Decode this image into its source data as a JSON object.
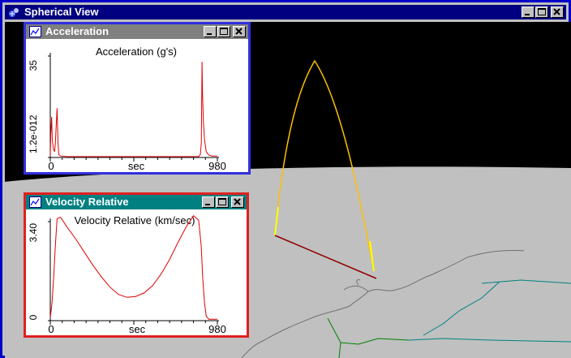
{
  "main_window": {
    "title": "Spherical View",
    "icon": "globe-app-icon",
    "controls": [
      "minimize-icon",
      "maximize-icon",
      "close-icon"
    ]
  },
  "acceleration_window": {
    "title": "Acceleration",
    "icon": "chart-icon",
    "controls": [
      "minimize-icon",
      "maximize-icon",
      "close-icon"
    ],
    "chart_data": {
      "type": "line",
      "title": "Acceleration (g's)",
      "xlabel": "sec",
      "x_tick_labels": [
        "0",
        "980"
      ],
      "y_tick_labels": [
        "1.2e-012",
        "35"
      ],
      "xlim": [
        0,
        980
      ],
      "ylim": [
        0,
        35
      ],
      "series": [
        {
          "color": "#e00000",
          "x": [
            0,
            3,
            8,
            12,
            18,
            25,
            30,
            34,
            40,
            45,
            50,
            60,
            100,
            300,
            600,
            870,
            880,
            886,
            888,
            890,
            893,
            898,
            905,
            915,
            930,
            950,
            980
          ],
          "y": [
            0.5,
            8,
            14,
            6,
            3,
            2,
            5,
            10,
            17,
            5,
            1,
            0.5,
            0.3,
            0.3,
            0.3,
            0.3,
            1,
            5,
            20,
            33,
            22,
            12,
            6,
            2,
            0.8,
            0.5,
            0.5
          ]
        }
      ]
    }
  },
  "velocity_window": {
    "title": "Velocity Relative",
    "icon": "chart-icon",
    "controls": [
      "minimize-icon",
      "maximize-icon",
      "close-icon"
    ],
    "chart_data": {
      "type": "line",
      "title": "Velocity Relative (km/sec)",
      "xlabel": "sec",
      "x_tick_labels": [
        "0",
        "980"
      ],
      "y_tick_labels": [
        "0",
        "3.40"
      ],
      "xlim": [
        0,
        980
      ],
      "ylim": [
        0,
        3.4
      ],
      "series": [
        {
          "color": "#e00000",
          "x": [
            0,
            10,
            20,
            30,
            40,
            60,
            100,
            150,
            200,
            250,
            300,
            350,
            400,
            450,
            500,
            550,
            600,
            650,
            700,
            750,
            800,
            840,
            870,
            885,
            895,
            905,
            915,
            930,
            950,
            980
          ],
          "y": [
            0.1,
            0.6,
            1.5,
            2.6,
            3.5,
            3.55,
            3.2,
            2.8,
            2.35,
            1.9,
            1.5,
            1.15,
            0.9,
            0.8,
            0.83,
            0.95,
            1.2,
            1.6,
            2.1,
            2.7,
            3.25,
            3.6,
            3.45,
            2.6,
            1.4,
            0.6,
            0.15,
            0.05,
            0.05,
            0.05
          ]
        }
      ]
    }
  },
  "scene": {
    "sky_color": "#000000",
    "earth_color": "#c0c0c0",
    "trajectory_colors": [
      "#ffff00",
      "#e00000",
      "#800000"
    ],
    "coastline_color": "#808080",
    "border_colors": [
      "#008080",
      "#008000"
    ]
  }
}
